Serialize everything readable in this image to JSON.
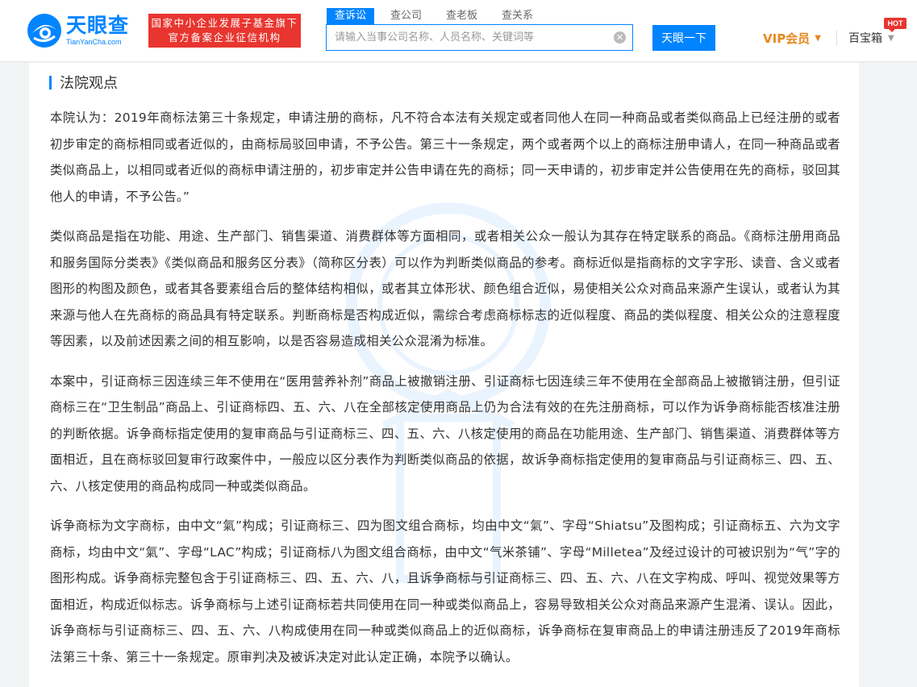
{
  "header": {
    "logo_cn": "天眼查",
    "logo_en": "TianYanCha.com",
    "badge_line1": "国家中小企业发展子基金旗下",
    "badge_line2": "官方备案企业征信机构",
    "tabs": [
      {
        "label": "查诉讼",
        "active": true
      },
      {
        "label": "查公司",
        "active": false
      },
      {
        "label": "查老板",
        "active": false
      },
      {
        "label": "查关系",
        "active": false
      }
    ],
    "search_placeholder": "请输入当事公司名称、人员名称、关键词等",
    "search_button": "天眼一下",
    "vip_label": "VIP会员",
    "baobao_label": "百宝箱",
    "hot_badge": "HOT"
  },
  "section": {
    "title": "法院观点"
  },
  "paragraphs": [
    "本院认为：2019年商标法第三十条规定，申请注册的商标，凡不符合本法有关规定或者同他人在同一种商品或者类似商品上已经注册的或者初步审定的商标相同或者近似的，由商标局驳回申请，不予公告。第三十一条规定，两个或者两个以上的商标注册申请人，在同一种商品或者类似商品上，以相同或者近似的商标申请注册的，初步审定并公告申请在先的商标；同一天申请的，初步审定并公告使用在先的商标，驳回其他人的申请，不予公告。”",
    "类似商品是指在功能、用途、生产部门、销售渠道、消费群体等方面相同，或者相关公众一般认为其存在特定联系的商品。《商标注册用商品和服务国际分类表》《类似商品和服务区分表》（简称区分表）可以作为判断类似商品的参考。商标近似是指商标的文字字形、读音、含义或者图形的构图及颜色，或者其各要素组合后的整体结构相似，或者其立体形状、颜色组合近似，易使相关公众对商品来源产生误认，或者认为其来源与他人在先商标的商品具有特定联系。判断商标是否构成近似，需综合考虑商标标志的近似程度、商品的类似程度、相关公众的注意程度等因素，以及前述因素之间的相互影响，以是否容易造成相关公众混淆为标准。",
    "本案中，引证商标三因连续三年不使用在“医用营养补剂”商品上被撤销注册、引证商标七因连续三年不使用在全部商品上被撤销注册，但引证商标三在“卫生制品”商品上、引证商标四、五、六、八在全部核定使用商品上仍为合法有效的在先注册商标，可以作为诉争商标能否核准注册的判断依据。诉争商标指定使用的复审商品与引证商标三、四、五、六、八核定使用的商品在功能用途、生产部门、销售渠道、消费群体等方面相近，且在商标驳回复审行政案件中，一般应以区分表作为判断类似商品的依据，故诉争商标指定使用的复审商品与引证商标三、四、五、六、八核定使用的商品构成同一种或类似商品。",
    "诉争商标为文字商标，由中文“氣”构成；引证商标三、四为图文组合商标，均由中文“氣”、字母“Shiatsu”及图构成；引证商标五、六为文字商标，均由中文“氣”、字母“LAC”构成；引证商标八为图文组合商标，由中文“气米茶铺”、字母“Milletea”及经过设计的可被识别为“气”字的图形构成。诉争商标完整包含于引证商标三、四、五、六、八，且诉争商标与引证商标三、四、五、六、八在文字构成、呼叫、视觉效果等方面相近，构成近似标志。诉争商标与上述引证商标若共同使用在同一种或类似商品上，容易导致相关公众对商品来源产生混淆、误认。因此，诉争商标与引证商标三、四、五、六、八构成使用在同一种或类似商品上的近似商标，诉争商标在复审商品上的申请注册违反了2019年商标法第三十条、第三十一条规定。原审判决及被诉决定对此认定正确，本院予以确认。"
  ]
}
